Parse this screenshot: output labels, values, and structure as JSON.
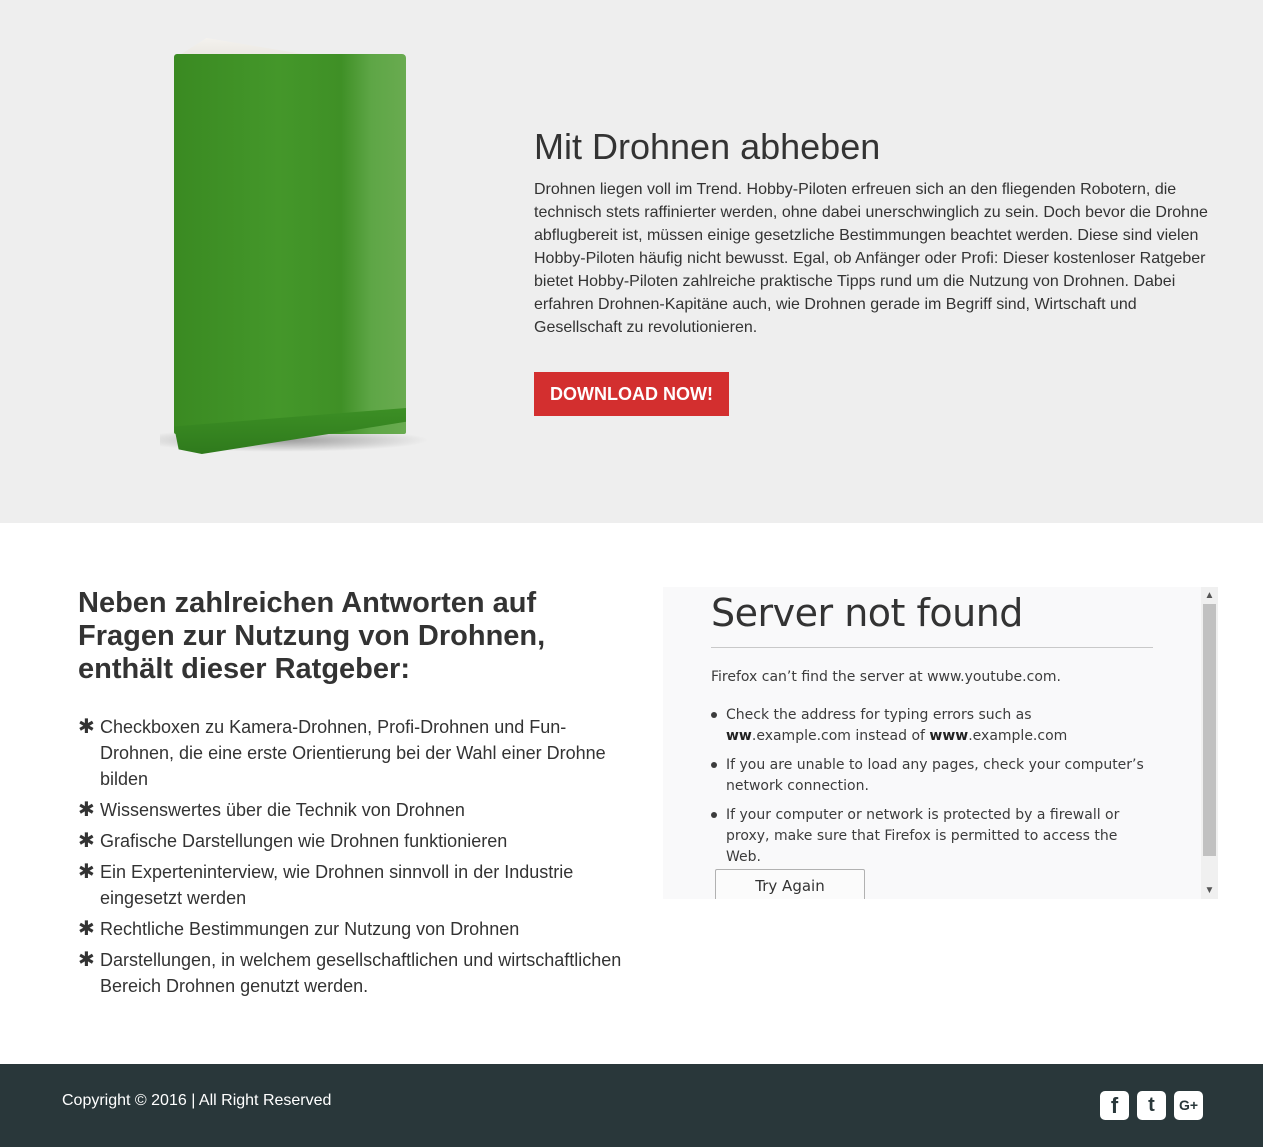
{
  "hero": {
    "title": "Mit Drohnen abheben",
    "text": "Drohnen liegen voll im Trend. Hobby-Piloten erfreuen sich an den fliegenden Robotern, die technisch stets raffinierter werden, ohne dabei unerschwinglich zu sein. Doch bevor die Drohne abflugbereit ist, müssen einige gesetzliche Bestimmungen beachtet werden. Diese sind vielen Hobby-Piloten häufig nicht bewusst. Egal, ob Anfänger oder Profi: Dieser kostenloser Ratgeber bietet Hobby-Piloten zahlreiche praktische Tipps rund um die Nutzung von Drohnen. Dabei erfahren Drohnen-Kapitäne auch, wie Drohnen gerade im Begriff sind, Wirtschaft und Gesellschaft zu revolutionieren.",
    "download_label": "DOWNLOAD NOW!",
    "book_color": "#44972a",
    "button_color": "#d32f2f"
  },
  "features": {
    "title": "Neben zahlreichen Antworten auf Fragen zur Nutzung von Drohnen, enthält dieser Ratgeber:",
    "bullet": "✱",
    "items": [
      "Checkboxen zu Kamera-Drohnen, Profi-Drohnen und Fun-Drohnen, die eine erste Orientierung bei der Wahl einer Drohne bilden",
      "Wissenswertes über die Technik von Drohnen",
      "Grafische Darstellungen wie Drohnen funktionieren",
      "Ein Experteninterview, wie Drohnen sinnvoll in der Industrie eingesetzt werden",
      "Rechtliche Bestimmungen zur Nutzung von Drohnen",
      "Darstellungen, in welchem gesellschaftlichen und wirtschaftlichen Bereich Drohnen genutzt werden."
    ]
  },
  "embed": {
    "title": "Server not found",
    "message": "Firefox can’t find the server at www.youtube.com.",
    "tips": {
      "tip1_pre": "Check the address for typing errors such as ",
      "tip1_b1": "ww",
      "tip1_mid": ".example.com instead of ",
      "tip1_b2": "www",
      "tip1_post": ".example.com",
      "tip2": "If you are unable to load any pages, check your computer’s network connection.",
      "tip3": "If your computer or network is protected by a firewall or proxy, make sure that Firefox is permitted to access the Web."
    },
    "try_again_label": "Try Again",
    "scroll_up": "▲",
    "scroll_down": "▼"
  },
  "footer": {
    "copyright": "Copyright © 2016 | All Right Reserved",
    "background": "#29373a",
    "socials": {
      "facebook": "f",
      "twitter": "t",
      "googleplus": "G+"
    }
  }
}
